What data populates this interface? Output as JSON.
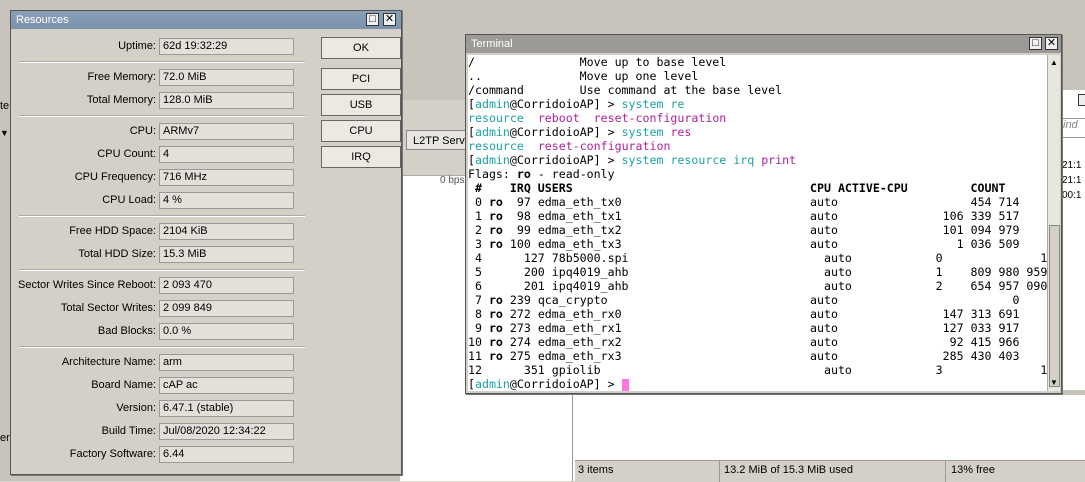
{
  "background": {
    "l2tp_button": "L2TP Serv",
    "bps": "0 bps",
    "right_times": [
      "21:1",
      "21:1",
      "00:1"
    ],
    "right_search": "ind",
    "status_bar": {
      "items": "3 items",
      "used": "13.2 MiB of 15.3 MiB used",
      "free": "13% free"
    },
    "left_labels": [
      "te",
      "er"
    ]
  },
  "resources": {
    "title": "Resources",
    "rows": [
      {
        "label": "Uptime:",
        "value": "62d 19:32:29"
      },
      {
        "label": "Free Memory:",
        "value": "72.0 MiB"
      },
      {
        "label": "Total Memory:",
        "value": "128.0 MiB"
      },
      {
        "label": "CPU:",
        "value": "ARMv7"
      },
      {
        "label": "CPU Count:",
        "value": "4"
      },
      {
        "label": "CPU Frequency:",
        "value": "716 MHz"
      },
      {
        "label": "CPU Load:",
        "value": "4 %"
      },
      {
        "label": "Free HDD Space:",
        "value": "2104 KiB"
      },
      {
        "label": "Total HDD Size:",
        "value": "15.3 MiB"
      },
      {
        "label": "Sector Writes Since Reboot:",
        "value": "2 093 470"
      },
      {
        "label": "Total Sector Writes:",
        "value": "2 099 849"
      },
      {
        "label": "Bad Blocks:",
        "value": "0.0 %"
      },
      {
        "label": "Architecture Name:",
        "value": "arm"
      },
      {
        "label": "Board Name:",
        "value": "cAP ac"
      },
      {
        "label": "Version:",
        "value": "6.47.1 (stable)"
      },
      {
        "label": "Build Time:",
        "value": "Jul/08/2020 12:34:22"
      },
      {
        "label": "Factory Software:",
        "value": "6.44"
      }
    ],
    "buttons": {
      "ok": "OK",
      "pci": "PCI",
      "usb": "USB",
      "cpu": "CPU",
      "irq": "IRQ"
    }
  },
  "terminal": {
    "title": "Terminal",
    "lines": [
      [
        {
          "t": "/               Move up to base level"
        }
      ],
      [
        {
          "t": "..              Move up one level"
        }
      ],
      [
        {
          "t": "/command        Use command at the base level"
        }
      ],
      [
        {
          "t": "["
        },
        {
          "t": "admin",
          "c": "c-teal"
        },
        {
          "t": "@CorridoioAP] > "
        },
        {
          "t": "system re",
          "c": "c-teal"
        }
      ],
      [
        {
          "t": "resource  ",
          "c": "c-teal"
        },
        {
          "t": "reboot  reset-configuration",
          "c": "c-mag"
        }
      ],
      [
        {
          "t": "["
        },
        {
          "t": "admin",
          "c": "c-teal"
        },
        {
          "t": "@CorridoioAP] > "
        },
        {
          "t": "system ",
          "c": "c-teal"
        },
        {
          "t": "res",
          "c": "c-mag"
        }
      ],
      [
        {
          "t": "resource  ",
          "c": "c-teal"
        },
        {
          "t": "reset-configuration",
          "c": "c-mag"
        }
      ],
      [
        {
          "t": "["
        },
        {
          "t": "admin",
          "c": "c-teal"
        },
        {
          "t": "@CorridoioAP] > "
        },
        {
          "t": "system resource irq ",
          "c": "c-teal"
        },
        {
          "t": "print",
          "c": "c-mag"
        }
      ],
      [
        {
          "t": "Flags: "
        },
        {
          "t": "ro",
          "c": "c-bold"
        },
        {
          "t": " - read-only"
        }
      ],
      [
        {
          "t": " #    IRQ USERS                                  CPU ACTIVE-CPU         COUNT",
          "c": "c-bold"
        }
      ],
      [
        {
          "t": " 0 "
        },
        {
          "t": "ro",
          "c": "c-bold"
        },
        {
          "t": "  97 edma_eth_tx0                           auto                   454 714"
        }
      ],
      [
        {
          "t": " 1 "
        },
        {
          "t": "ro",
          "c": "c-bold"
        },
        {
          "t": "  98 edma_eth_tx1                           auto               106 339 517"
        }
      ],
      [
        {
          "t": " 2 "
        },
        {
          "t": "ro",
          "c": "c-bold"
        },
        {
          "t": "  99 edma_eth_tx2                           auto               101 094 979"
        }
      ],
      [
        {
          "t": " 3 "
        },
        {
          "t": "ro",
          "c": "c-bold"
        },
        {
          "t": " 100 edma_eth_tx3                           auto                 1 036 509"
        }
      ],
      [
        {
          "t": " 4      127 78b5000.spi                            auto            0              1"
        }
      ],
      [
        {
          "t": " 5      200 ipq4019_ahb                            auto            1    809 980 959"
        }
      ],
      [
        {
          "t": " 6      201 ipq4019_ahb                            auto            2    654 957 090"
        }
      ],
      [
        {
          "t": " 7 "
        },
        {
          "t": "ro",
          "c": "c-bold"
        },
        {
          "t": " 239 qca_crypto                             auto                         0"
        }
      ],
      [
        {
          "t": " 8 "
        },
        {
          "t": "ro",
          "c": "c-bold"
        },
        {
          "t": " 272 edma_eth_rx0                           auto               147 313 691"
        }
      ],
      [
        {
          "t": " 9 "
        },
        {
          "t": "ro",
          "c": "c-bold"
        },
        {
          "t": " 273 edma_eth_rx1                           auto               127 033 917"
        }
      ],
      [
        {
          "t": "10 "
        },
        {
          "t": "ro",
          "c": "c-bold"
        },
        {
          "t": " 274 edma_eth_rx2                           auto                92 415 966"
        }
      ],
      [
        {
          "t": "11 "
        },
        {
          "t": "ro",
          "c": "c-bold"
        },
        {
          "t": " 275 edma_eth_rx3                           auto               285 430 403"
        }
      ],
      [
        {
          "t": "12      351 gpiolib                                auto            3              1"
        }
      ],
      [
        {
          "t": "["
        },
        {
          "t": "admin",
          "c": "c-teal"
        },
        {
          "t": "@CorridoioAP] > "
        },
        {
          "cursor": true
        }
      ]
    ]
  },
  "icons": {
    "maximize": "□",
    "close": "✕",
    "scroll_up": "▲",
    "scroll_down": "▼"
  }
}
